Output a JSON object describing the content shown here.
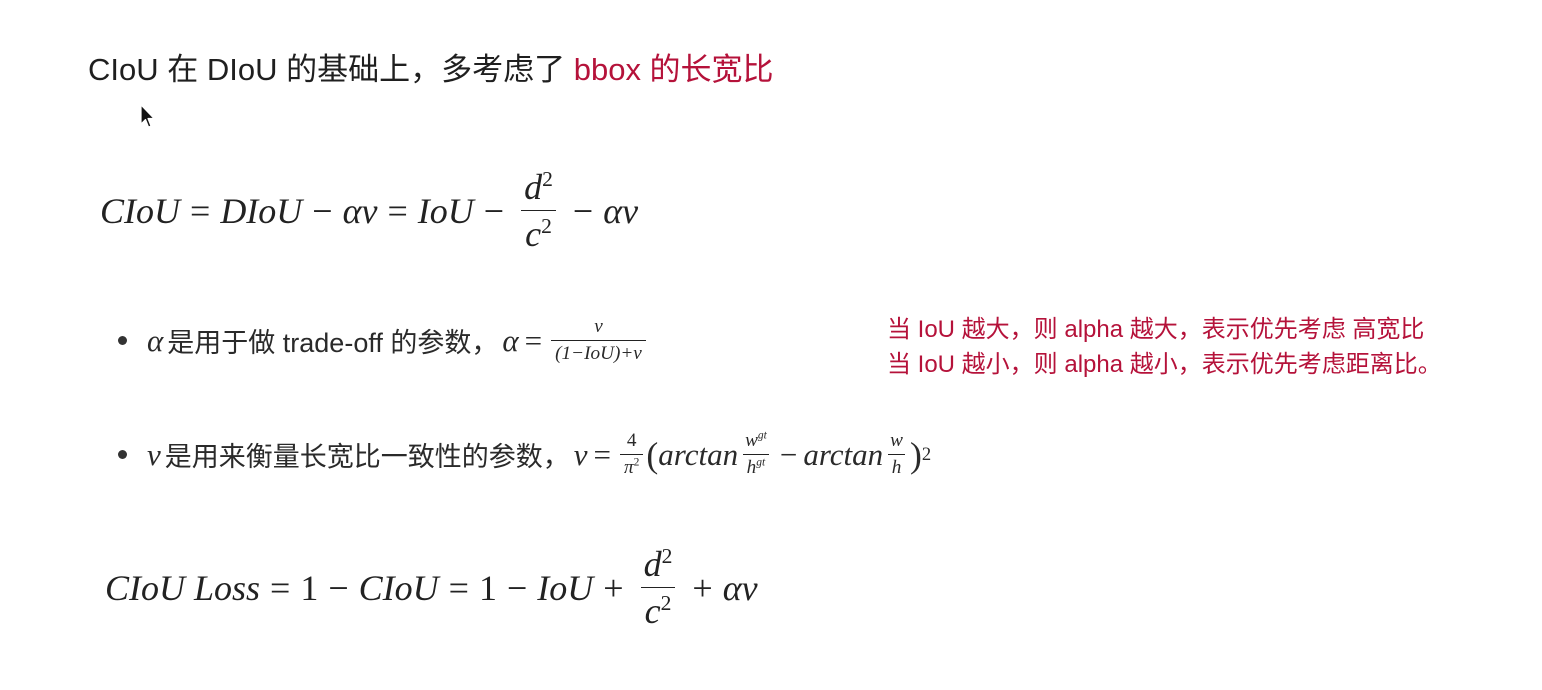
{
  "heading": {
    "text": "CIoU 在 DIoU 的基础上，多考虑了 ",
    "highlight": "bbox 的长宽比"
  },
  "equation1": {
    "lhs": "CIoU",
    "eq": "=",
    "t1": "DIoU",
    "minus": "−",
    "t2": "αv",
    "eq2": "=",
    "t3": "IoU",
    "minus2": "−",
    "frac_num": "d",
    "frac_den": "c",
    "exp": "2",
    "minus3": "−",
    "t4": "αv"
  },
  "bullet1": {
    "alpha": "α",
    "text": "是用于做 trade-off 的参数，",
    "formula_lhs": "α",
    "eq": "=",
    "num": "v",
    "den": "(1−IoU)+v"
  },
  "bullet2": {
    "v": "v",
    "text": "是用来衡量长宽比一致性的参数，",
    "formula_lhs": "v",
    "eq": "=",
    "num": "4",
    "den": "π",
    "exp": "2",
    "lparen": "(",
    "arctan1": "arctan",
    "w1": "w",
    "gt1": "gt",
    "h1": "h",
    "gt2": "gt",
    "minus": "−",
    "arctan2": "arctan",
    "w2": "w",
    "h2": "h",
    "rparen": ")",
    "exp2": "2"
  },
  "notes": {
    "line1": "当 IoU 越大，则 alpha 越大，表示优先考虑 高宽比",
    "line2": "当 IoU 越小，则 alpha 越小，表示优先考虑距离比。"
  },
  "equation2": {
    "lhs1": "CIoU",
    "lhs2": "Loss",
    "eq": "=",
    "one": "1",
    "minus": "−",
    "t1": "CIoU",
    "eq2": "=",
    "one2": "1",
    "minus2": "−",
    "t2": "IoU",
    "plus": "+",
    "frac_num": "d",
    "frac_den": "c",
    "exp": "2",
    "plus2": "+",
    "t3": "αv"
  },
  "colors": {
    "accent": "#b5123a",
    "text": "#222222",
    "background": "#ffffff"
  },
  "icons": {
    "cursor": "mouse-pointer-icon"
  }
}
